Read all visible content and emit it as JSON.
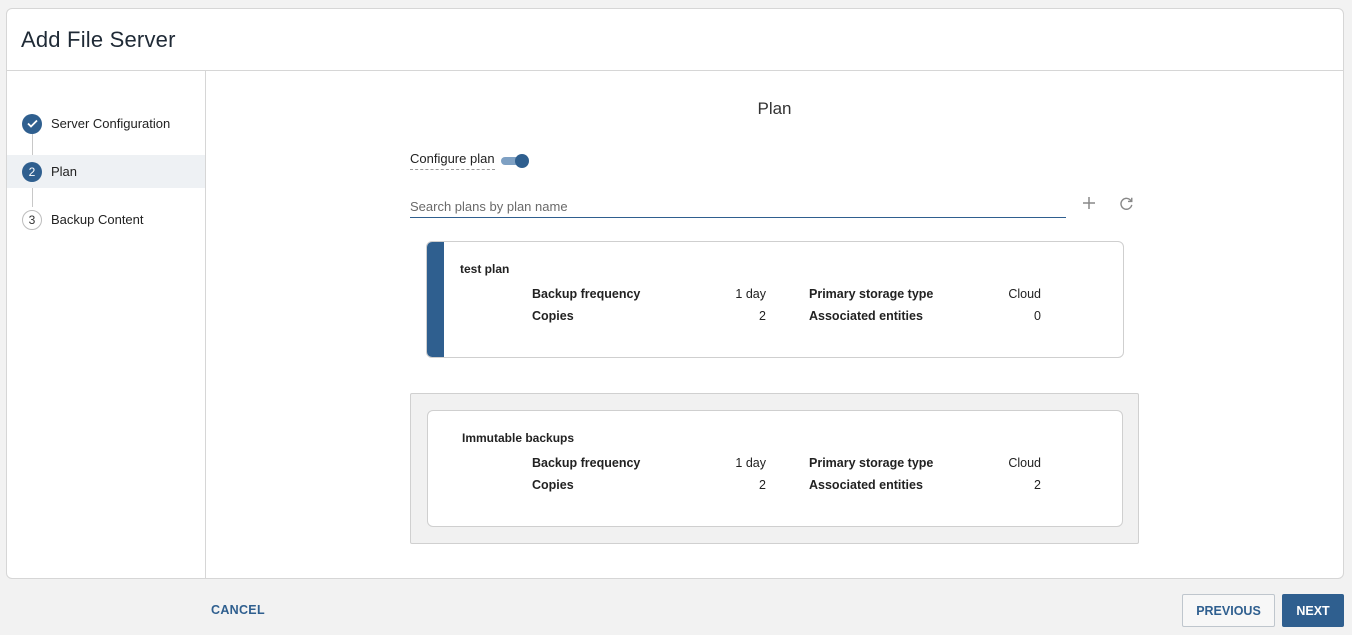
{
  "dialog": {
    "title": "Add File Server"
  },
  "steps": [
    {
      "number": "1",
      "label": "Server Configuration",
      "state": "done"
    },
    {
      "number": "2",
      "label": "Plan",
      "state": "current"
    },
    {
      "number": "3",
      "label": "Backup Content",
      "state": "todo"
    }
  ],
  "main": {
    "section_title": "Plan",
    "configure_plan_label": "Configure plan",
    "configure_plan_enabled": true,
    "search_placeholder": "Search plans by plan name",
    "search_value": ""
  },
  "plans": [
    {
      "name": "test plan",
      "selected": true,
      "backup_frequency_label": "Backup frequency",
      "backup_frequency": "1 day",
      "copies_label": "Copies",
      "copies": "2",
      "primary_storage_type_label": "Primary storage type",
      "primary_storage_type": "Cloud",
      "associated_entities_label": "Associated entities",
      "associated_entities": "0"
    },
    {
      "name": "Immutable backups",
      "selected": false,
      "backup_frequency_label": "Backup frequency",
      "backup_frequency": "1 day",
      "copies_label": "Copies",
      "copies": "2",
      "primary_storage_type_label": "Primary storage type",
      "primary_storage_type": "Cloud",
      "associated_entities_label": "Associated entities",
      "associated_entities": "2"
    }
  ],
  "footer": {
    "cancel": "CANCEL",
    "previous": "PREVIOUS",
    "next": "NEXT"
  },
  "colors": {
    "accent": "#2f5f8f"
  },
  "icons": {
    "add": "plus-icon",
    "refresh": "refresh-icon",
    "step_done": "check-icon"
  }
}
